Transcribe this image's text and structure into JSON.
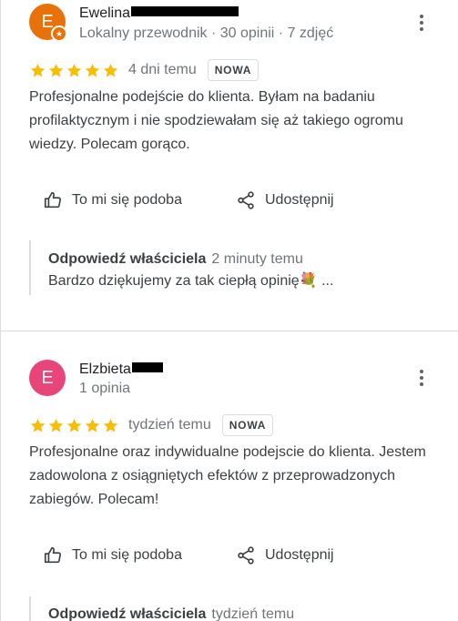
{
  "reviews": [
    {
      "author": {
        "initial": "E",
        "name": "Ewelina",
        "meta": "Lokalny przewodnik · 30 opinii · 7 zdjęć",
        "avatar_color": "#e8710a",
        "badge_icon": "local-guide-star-icon"
      },
      "rating": 5,
      "date": "4 dni temu",
      "badge": "NOWA",
      "text": "Profesjonalne podejście do klienta. Byłam na badaniu profilaktycznym i nie spodziewałam się aż takiego ogromu wiedzy. Polecam gorąco.",
      "actions": {
        "like": "To mi się podoba",
        "share": "Udostępnij"
      },
      "reply": {
        "owner": "Odpowiedź właściciela",
        "time": "2 minuty temu",
        "text": "Bardzo dziękujemy za tak ciepłą opinię💐 ..."
      }
    },
    {
      "author": {
        "initial": "E",
        "name": "Elzbieta",
        "meta": "1 opinia",
        "avatar_color": "#e8457a"
      },
      "rating": 5,
      "date": "tydzień temu",
      "badge": "NOWA",
      "text": "Profesjonalne oraz indywidualne podejscie do klienta. Jestem zadowolona z osiągniętych efektów z przeprowadzonych zabiegów. Polecam!",
      "actions": {
        "like": "To mi się podoba",
        "share": "Udostępnij"
      },
      "reply": {
        "owner": "Odpowiedź właściciela",
        "time": "tydzień temu"
      }
    }
  ],
  "colors": {
    "star": "#fbbc04",
    "divider": "#dadce0",
    "secondary_text": "#70757a"
  }
}
